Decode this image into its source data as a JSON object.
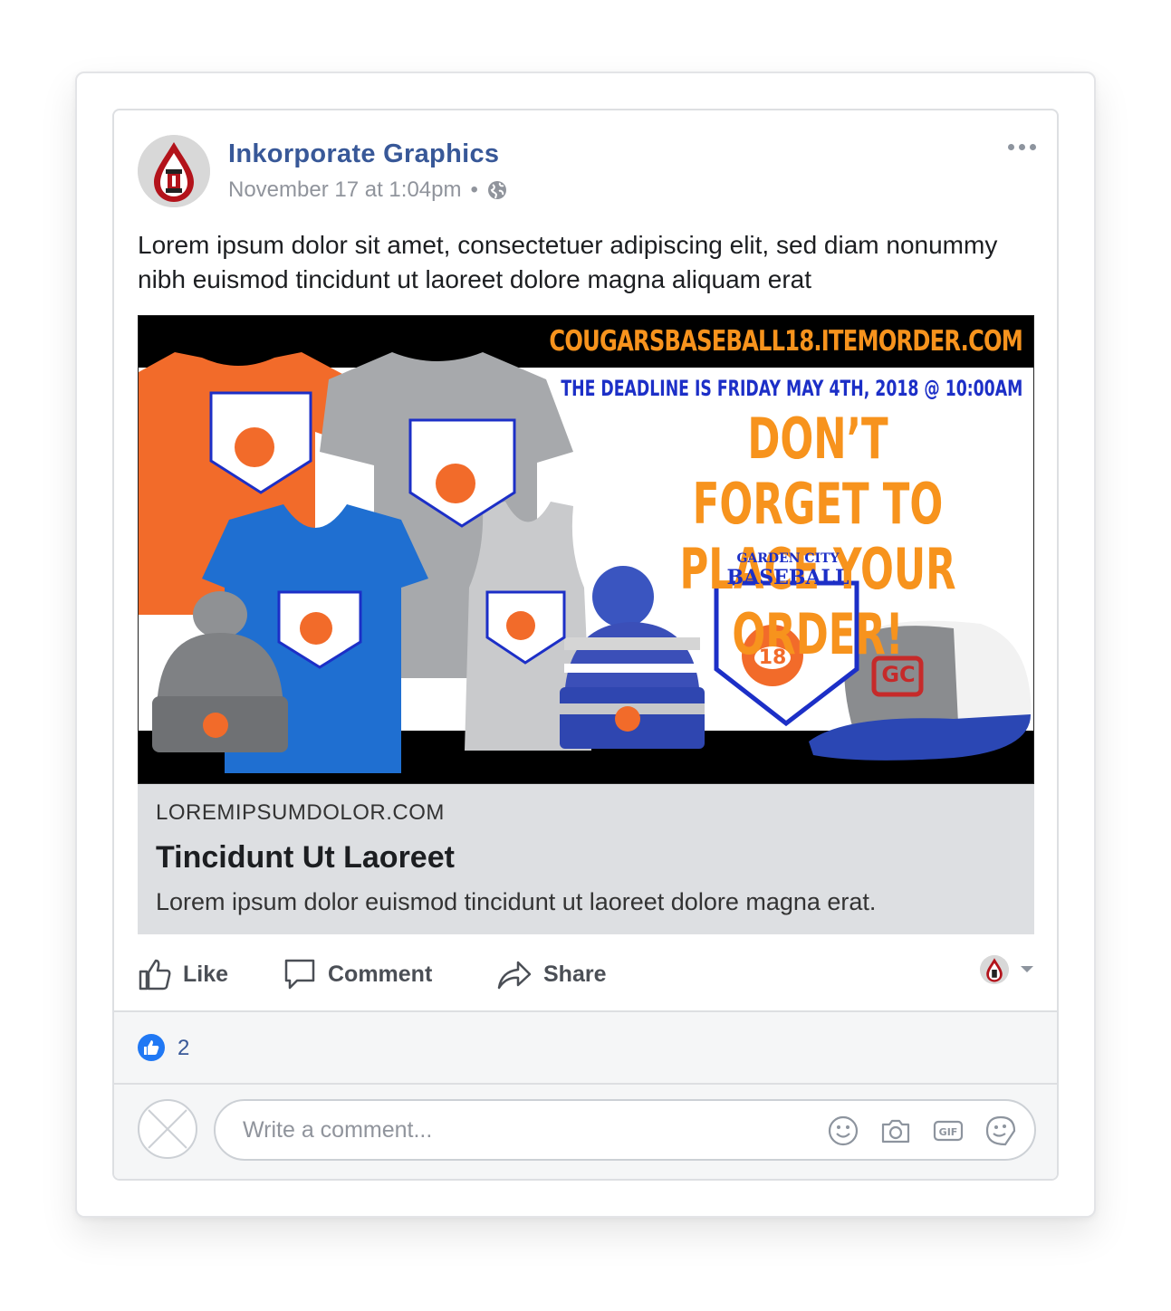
{
  "post": {
    "author": "Inkorporate Graphics",
    "timestamp": "November 17 at 1:04pm",
    "separator": "•",
    "privacy_icon": "globe-icon",
    "text": "Lorem ipsum dolor sit amet, consectetuer adipiscing elit, sed diam nonummy nibh euismod tincidunt ut laoreet dolore magna aliquam erat"
  },
  "banner": {
    "url": "COUGARSBASEBALL18.ITEMORDER.COM",
    "deadline": "THE DEADLINE IS FRIDAY MAY 4TH, 2018 @ 10:00AM",
    "headline_line1": "DON’T FORGET TO",
    "headline_line2": "PLACE YOUR ORDER!",
    "logo_line1": "GARDEN CITY",
    "logo_line2": "BASEBALL",
    "logo_number": "18",
    "cap_logo": "GC"
  },
  "link": {
    "domain": "LOREMIPSUMDOLOR.COM",
    "title": "Tincidunt Ut Laoreet",
    "description": "Lorem ipsum dolor euismod tincidunt ut laoreet dolore magna erat."
  },
  "actions": {
    "like": "Like",
    "comment": "Comment",
    "share": "Share"
  },
  "reactions": {
    "count": "2"
  },
  "comment": {
    "placeholder": "Write a comment..."
  },
  "colors": {
    "brand_blue": "#385898",
    "like_blue": "#2078f4",
    "banner_orange": "#f7931d",
    "banner_blue": "#1c2fc7"
  }
}
